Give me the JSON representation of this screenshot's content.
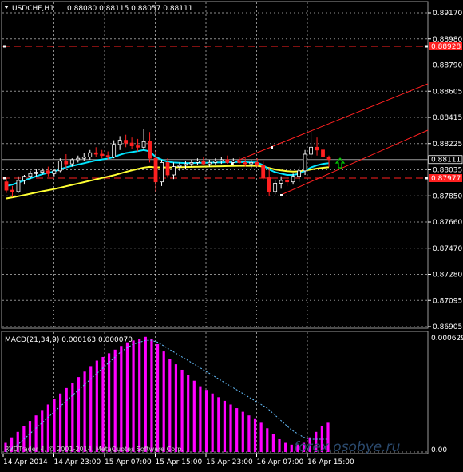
{
  "header": {
    "symbol_timeframe": "USDCHF,H1",
    "ohlc": "0.88080 0.88115 0.88057 0.88111"
  },
  "price_axis": {
    "ticks": [
      "0.89170",
      "0.88980",
      "0.88790",
      "0.88605",
      "0.88415",
      "0.88225",
      "0.88035",
      "0.87850",
      "0.87660",
      "0.87470",
      "0.87280",
      "0.87095",
      "0.86905"
    ]
  },
  "badges": {
    "upper_level": "0.88928",
    "current_price": "0.88111",
    "lower_level": "0.87977"
  },
  "macd": {
    "label": "MACD(21,34,9) 0.000163 0.000070",
    "top_value": "0.000629",
    "bottom_value": "0.00"
  },
  "watermarks": {
    "copyright": "RVDTrader 4, © 2001-2014, MetaQuotes Software Corp.",
    "site": "forex.osobye.ru"
  },
  "time_axis": {
    "labels": [
      "14 Apr 2014",
      "14 Apr 23:00",
      "15 Apr 07:00",
      "15 Apr 15:00",
      "15 Apr 23:00",
      "16 Apr 07:00",
      "16 Apr 15:00"
    ]
  },
  "colors": {
    "background": "#000000",
    "grid": "#ffffff",
    "candle_up": "#ffffff",
    "candle_down": "#ff2020",
    "ma_fast": "#00e5ff",
    "ma_slow": "#ffff33",
    "channel": "#ff2020",
    "level_line": "#ff2020",
    "macd_hist": "#ff00ff",
    "macd_signal": "#66c0ff",
    "arrow": "#00d000"
  },
  "chart_data": {
    "type": "candlestick",
    "symbol": "USDCHF",
    "timeframe": "H1",
    "y_range": [
      0.86905,
      0.8917
    ],
    "levels": [
      0.88928,
      0.87977
    ],
    "current_price": 0.88111,
    "candles": [
      [
        0.8795,
        0.8798,
        0.8787,
        0.8789
      ],
      [
        0.8789,
        0.8792,
        0.8784,
        0.8788
      ],
      [
        0.8788,
        0.8799,
        0.8787,
        0.8796
      ],
      [
        0.8796,
        0.88,
        0.8793,
        0.8799
      ],
      [
        0.8799,
        0.8803,
        0.8797,
        0.8801
      ],
      [
        0.8801,
        0.8804,
        0.8799,
        0.8802
      ],
      [
        0.8802,
        0.8805,
        0.88,
        0.8803
      ],
      [
        0.8803,
        0.8806,
        0.8799,
        0.8801
      ],
      [
        0.8801,
        0.8804,
        0.8799,
        0.8803
      ],
      [
        0.8803,
        0.8812,
        0.8802,
        0.881
      ],
      [
        0.881,
        0.8815,
        0.8805,
        0.8808
      ],
      [
        0.8808,
        0.8812,
        0.8806,
        0.8811
      ],
      [
        0.8811,
        0.8814,
        0.8809,
        0.8812
      ],
      [
        0.8812,
        0.8816,
        0.881,
        0.8813
      ],
      [
        0.8813,
        0.8818,
        0.8811,
        0.8816
      ],
      [
        0.8816,
        0.882,
        0.8813,
        0.8815
      ],
      [
        0.8815,
        0.8818,
        0.8812,
        0.8814
      ],
      [
        0.8814,
        0.8817,
        0.8811,
        0.8813
      ],
      [
        0.8813,
        0.8825,
        0.8812,
        0.8822
      ],
      [
        0.8822,
        0.8828,
        0.8818,
        0.8825
      ],
      [
        0.8825,
        0.8829,
        0.882,
        0.8823
      ],
      [
        0.8823,
        0.8827,
        0.8819,
        0.8821
      ],
      [
        0.8821,
        0.8826,
        0.8817,
        0.882
      ],
      [
        0.882,
        0.8833,
        0.8818,
        0.8824
      ],
      [
        0.8824,
        0.8831,
        0.8809,
        0.8812
      ],
      [
        0.8812,
        0.8817,
        0.8788,
        0.8795
      ],
      [
        0.8795,
        0.8811,
        0.8792,
        0.8809
      ],
      [
        0.8809,
        0.8812,
        0.8798,
        0.88
      ],
      [
        0.88,
        0.8809,
        0.8797,
        0.8806
      ],
      [
        0.8806,
        0.8809,
        0.8803,
        0.8807
      ],
      [
        0.8807,
        0.881,
        0.8804,
        0.8808
      ],
      [
        0.8808,
        0.8811,
        0.8806,
        0.8809
      ],
      [
        0.8809,
        0.8812,
        0.8807,
        0.881
      ],
      [
        0.881,
        0.8813,
        0.8807,
        0.8808
      ],
      [
        0.8808,
        0.8811,
        0.8806,
        0.8809
      ],
      [
        0.8809,
        0.8812,
        0.8807,
        0.881
      ],
      [
        0.881,
        0.8813,
        0.8808,
        0.8811
      ],
      [
        0.8811,
        0.8814,
        0.8808,
        0.8809
      ],
      [
        0.8809,
        0.8812,
        0.8807,
        0.881
      ],
      [
        0.881,
        0.8813,
        0.8808,
        0.8809
      ],
      [
        0.8809,
        0.8812,
        0.8806,
        0.8808
      ],
      [
        0.8808,
        0.8811,
        0.8805,
        0.8809
      ],
      [
        0.8809,
        0.8812,
        0.8806,
        0.8807
      ],
      [
        0.8807,
        0.881,
        0.8796,
        0.8798
      ],
      [
        0.8798,
        0.8805,
        0.8785,
        0.8788
      ],
      [
        0.8788,
        0.8796,
        0.8786,
        0.8794
      ],
      [
        0.8794,
        0.8799,
        0.879,
        0.8796
      ],
      [
        0.8796,
        0.8799,
        0.8792,
        0.8795
      ],
      [
        0.8795,
        0.8801,
        0.8793,
        0.8799
      ],
      [
        0.8799,
        0.8806,
        0.8795,
        0.8803
      ],
      [
        0.8803,
        0.8818,
        0.88,
        0.8815
      ],
      [
        0.8815,
        0.8832,
        0.8812,
        0.882
      ],
      [
        0.882,
        0.8827,
        0.8814,
        0.8818
      ],
      [
        0.8818,
        0.8822,
        0.8812,
        0.8813
      ],
      [
        0.8813,
        0.8814,
        0.88057,
        0.88111
      ]
    ],
    "ma_fast": [
      0.8792,
      0.8793,
      0.87945,
      0.8796,
      0.87975,
      0.8799,
      0.88005,
      0.88015,
      0.88025,
      0.8804,
      0.88055,
      0.88065,
      0.88075,
      0.88085,
      0.88095,
      0.88105,
      0.88112,
      0.88118,
      0.8813,
      0.88145,
      0.88158,
      0.88165,
      0.88172,
      0.8818,
      0.8817,
      0.8813,
      0.8811,
      0.88095,
      0.8809,
      0.88088,
      0.88086,
      0.88086,
      0.88088,
      0.88088,
      0.88089,
      0.8809,
      0.88091,
      0.88092,
      0.88093,
      0.88093,
      0.88092,
      0.88091,
      0.8809,
      0.8807,
      0.8804,
      0.8802,
      0.8801,
      0.88,
      0.88,
      0.88008,
      0.8803,
      0.88055,
      0.8807,
      0.8808,
      0.88085
    ],
    "ma_slow": [
      0.8783,
      0.87838,
      0.87846,
      0.87855,
      0.87864,
      0.87873,
      0.87882,
      0.8789,
      0.87898,
      0.87908,
      0.87918,
      0.87928,
      0.87938,
      0.87948,
      0.87958,
      0.87968,
      0.87978,
      0.87988,
      0.87998,
      0.8801,
      0.88022,
      0.88033,
      0.88043,
      0.88053,
      0.88058,
      0.88055,
      0.88055,
      0.88054,
      0.88055,
      0.88056,
      0.88057,
      0.88058,
      0.88059,
      0.8806,
      0.88061,
      0.88062,
      0.88063,
      0.88064,
      0.88065,
      0.88066,
      0.88066,
      0.88066,
      0.88066,
      0.8806,
      0.8805,
      0.8804,
      0.88033,
      0.88027,
      0.88025,
      0.88026,
      0.88032,
      0.8804,
      0.88046,
      0.88052,
      0.88056
    ],
    "macd_histogram": [
      5e-05,
      8e-05,
      0.00011,
      0.00014,
      0.00017,
      0.0002,
      0.00023,
      0.00026,
      0.00029,
      0.00032,
      0.00035,
      0.00038,
      0.00041,
      0.00044,
      0.00047,
      0.0005,
      0.00052,
      0.00054,
      0.00056,
      0.00058,
      0.0006,
      0.00061,
      0.00062,
      0.00063,
      0.00062,
      0.00059,
      0.00055,
      0.00051,
      0.00048,
      0.00045,
      0.00042,
      0.00039,
      0.00036,
      0.00034,
      0.00032,
      0.0003,
      0.00028,
      0.00026,
      0.00024,
      0.00022,
      0.0002,
      0.00018,
      0.00016,
      0.00013,
      0.0001,
      7e-05,
      5e-05,
      4e-05,
      4e-05,
      5e-05,
      8e-05,
      0.00011,
      0.00014,
      0.00016
    ],
    "macd_signal": [
      0.0,
      2e-05,
      4e-05,
      7e-05,
      0.0001,
      0.00013,
      0.00016,
      0.00019,
      0.00022,
      0.00025,
      0.00028,
      0.00031,
      0.00034,
      0.00037,
      0.0004,
      0.00043,
      0.00046,
      0.00049,
      0.00052,
      0.00055,
      0.00057,
      0.00059,
      0.0006,
      0.00061,
      0.00061,
      0.0006,
      0.00058,
      0.00056,
      0.00054,
      0.00052,
      0.0005,
      0.00048,
      0.00046,
      0.00044,
      0.00042,
      0.0004,
      0.00038,
      0.00036,
      0.00034,
      0.00032,
      0.0003,
      0.00028,
      0.00026,
      0.00024,
      0.00021,
      0.00018,
      0.00015,
      0.00012,
      0.0001,
      8e-05,
      7e-05,
      7e-05,
      7e-05,
      7e-05
    ],
    "macd_y_range": [
      0.0,
      0.000629
    ]
  }
}
